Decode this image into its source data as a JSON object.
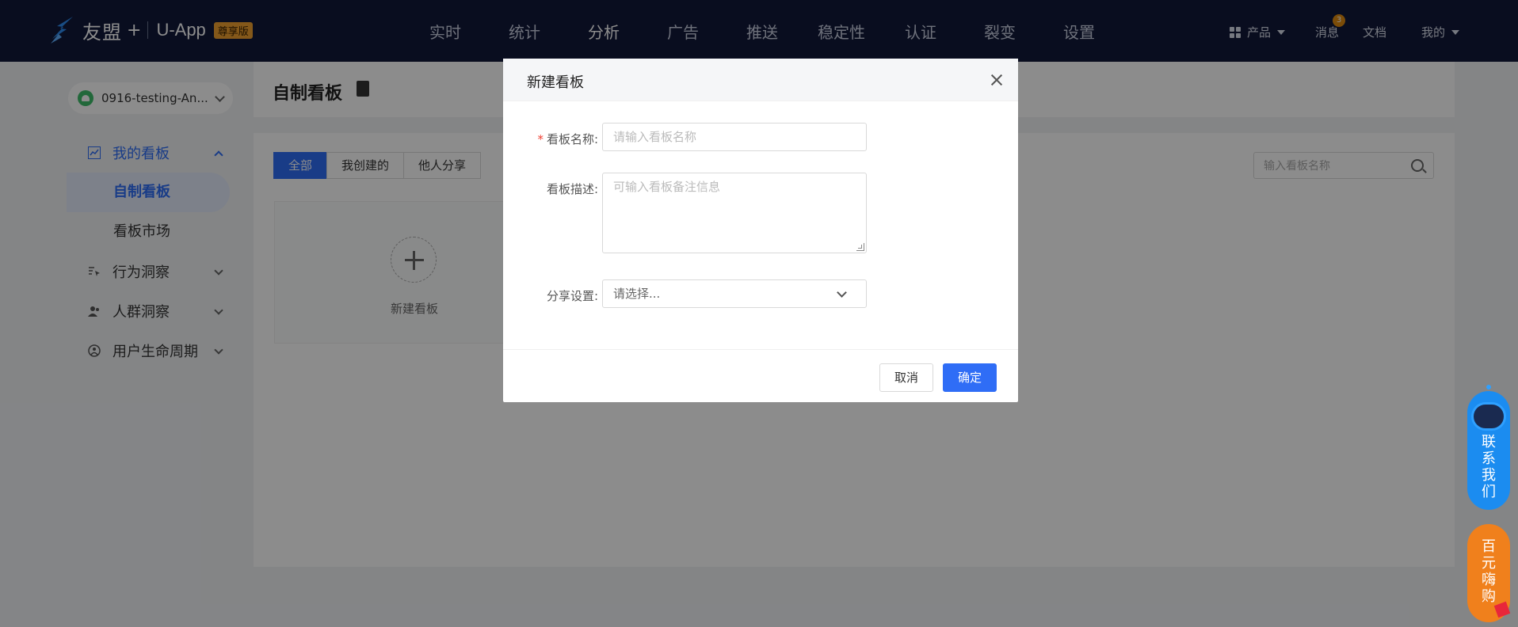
{
  "brand": {
    "name": "友盟",
    "plus": "+",
    "app": "U-App",
    "edition": "尊享版"
  },
  "nav": [
    "实时",
    "统计",
    "分析",
    "广告",
    "推送",
    "稳定性",
    "认证",
    "裂变",
    "设置"
  ],
  "nav_active": "分析",
  "tools": {
    "products": "产品",
    "messages": "消息",
    "message_count": "3",
    "docs": "文档",
    "me": "我的"
  },
  "sidebar": {
    "app_select": "0916-testing-An...",
    "groups": [
      {
        "label": "我的看板",
        "icon": "chart-icon",
        "expanded": true,
        "items": [
          {
            "label": "自制看板",
            "active": true
          },
          {
            "label": "看板市场",
            "active": false
          }
        ]
      },
      {
        "label": "行为洞察",
        "icon": "cursor-icon"
      },
      {
        "label": "人群洞察",
        "icon": "people-icon"
      },
      {
        "label": "用户生命周期",
        "icon": "lifecycle-icon"
      }
    ]
  },
  "page": {
    "title": "自制看板",
    "tabs": [
      "全部",
      "我创建的",
      "他人分享"
    ],
    "active_tab": "全部",
    "search_placeholder": "输入看板名称",
    "new_board_label": "新建看板"
  },
  "dialog": {
    "title": "新建看板",
    "name_label": "看板名称:",
    "required_mark": "*",
    "name_placeholder": "请输入看板名称",
    "desc_label": "看板描述:",
    "desc_placeholder": "可输入看板备注信息",
    "share_label": "分享设置:",
    "share_placeholder": "请选择...",
    "cancel": "取消",
    "confirm": "确定"
  },
  "floating": {
    "contact": "联系我们",
    "buy": "百元嗨购"
  },
  "colors": {
    "topbar": "#12193a",
    "accent": "#2f6df6",
    "contact_widget": "#1b8cf0",
    "buy_widget": "#f0801c",
    "edition_badge": "#f0a030"
  }
}
